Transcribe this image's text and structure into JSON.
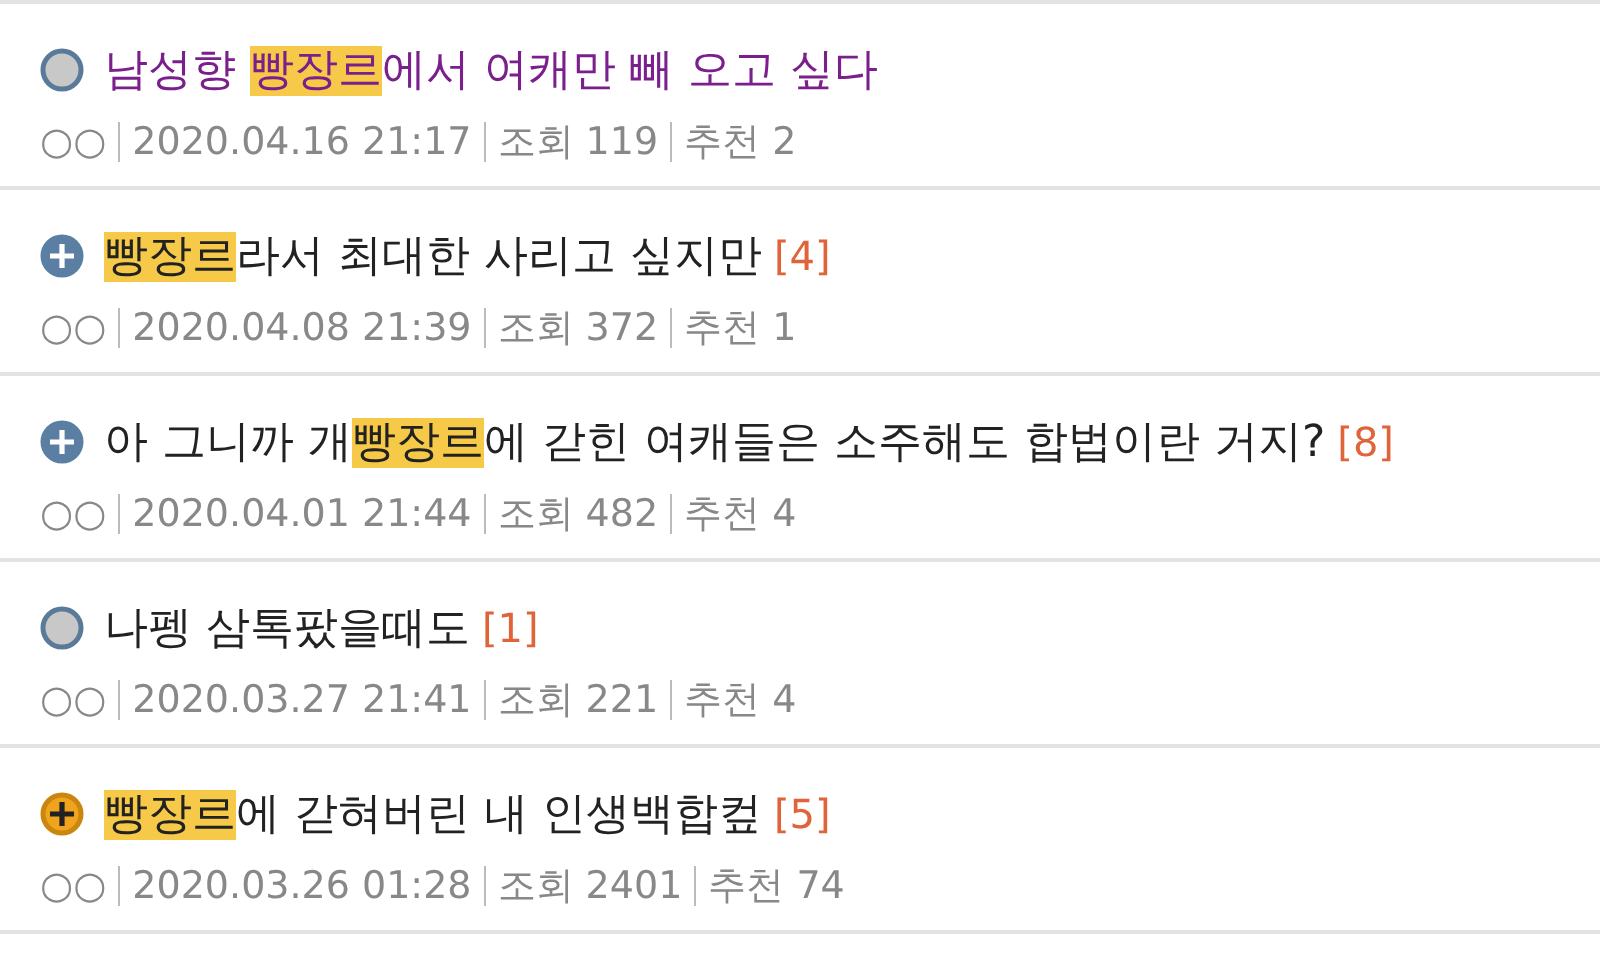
{
  "posts": [
    {
      "kind": "grey",
      "visited": true,
      "title": [
        {
          "text": "남성향 ",
          "highlight": false
        },
        {
          "text": "빵장르",
          "highlight": true
        },
        {
          "text": "에서 여캐만 빼 오고 싶다",
          "highlight": false
        }
      ],
      "author": "○○",
      "date": "2020.04.16 21:17",
      "views": "조회 119",
      "likes": "추천 2"
    },
    {
      "kind": "blue",
      "visited": false,
      "title": [
        {
          "text": "빵장르",
          "highlight": true
        },
        {
          "text": "라서 최대한 사리고 싶지만",
          "highlight": false
        }
      ],
      "comments": "[4]",
      "author": "○○",
      "date": "2020.04.08 21:39",
      "views": "조회 372",
      "likes": "추천 1"
    },
    {
      "kind": "blue",
      "visited": false,
      "title": [
        {
          "text": "아 그니까 개",
          "highlight": false
        },
        {
          "text": "빵장르",
          "highlight": true
        },
        {
          "text": "에 갇힌 여캐들은 소주해도 합법이란 거지?",
          "highlight": false
        }
      ],
      "comments": "[8]",
      "author": "○○",
      "date": "2020.04.01 21:44",
      "views": "조회 482",
      "likes": "추천 4"
    },
    {
      "kind": "grey",
      "visited": false,
      "title": [
        {
          "text": "나펭 삼톡팠을때도",
          "highlight": false
        }
      ],
      "comments": "[1]",
      "author": "○○",
      "date": "2020.03.27 21:41",
      "views": "조회 221",
      "likes": "추천 4"
    },
    {
      "kind": "orange",
      "visited": false,
      "title": [
        {
          "text": "빵장르",
          "highlight": true
        },
        {
          "text": "에 갇혀버린 내 인생백합컾",
          "highlight": false
        }
      ],
      "comments": "[5]",
      "author": "○○",
      "date": "2020.03.26 01:28",
      "views": "조회 2401",
      "likes": "추천 74"
    }
  ]
}
